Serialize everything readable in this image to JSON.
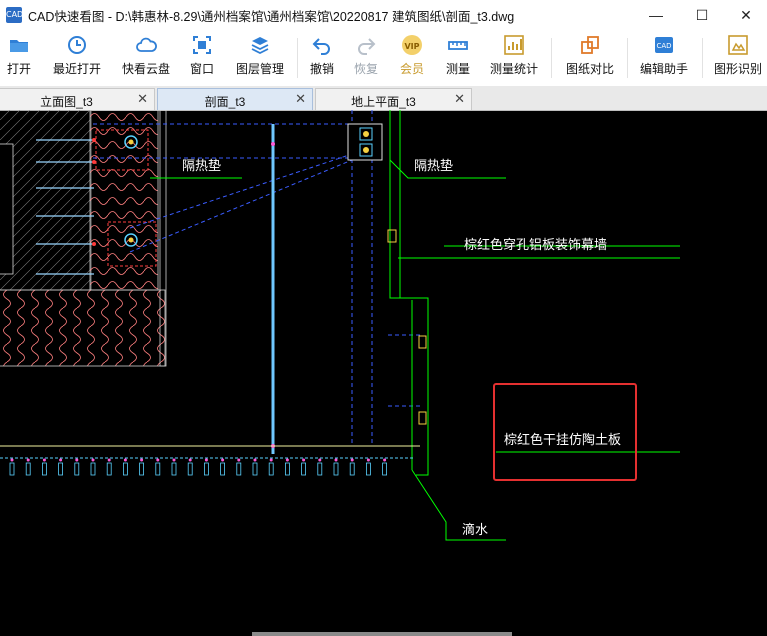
{
  "window": {
    "app_icon_text": "CAD",
    "title": "CAD快速看图 - D:\\韩惠林-8.29\\通州档案馆\\通州档案馆\\20220817 建筑图纸\\剖面_t3.dwg",
    "minimize_symbol": "—",
    "maximize_symbol": "☐",
    "close_symbol": "✕"
  },
  "toolbar": {
    "open": "打开",
    "recent": "最近打开",
    "cloud": "快看云盘",
    "window": "窗口",
    "layers": "图层管理",
    "undo": "撤销",
    "redo": "恢复",
    "vip_badge": "VIP",
    "member": "会员",
    "measure": "测量",
    "measure_stats": "测量统计",
    "compare": "图纸对比",
    "edit_assistant": "编辑助手",
    "shape_recognition": "图形识别"
  },
  "tabs": [
    {
      "label": "立面图_t3",
      "active": false
    },
    {
      "label": "剖面_t3",
      "active": true
    },
    {
      "label": "地上平面_t3",
      "active": false
    }
  ],
  "tab_close": "✕",
  "drawing": {
    "label_insulation_left": "隔热垫",
    "label_insulation_right": "隔热垫",
    "label_curtain_wall": "棕红色穿孔铝板装饰幕墙",
    "label_ceramic_board": "棕红色干挂仿陶土板",
    "label_drip": "滴水",
    "highlight_color": "#e53030",
    "line_color": "#00ff00",
    "hatch_color": "#ff8080"
  }
}
